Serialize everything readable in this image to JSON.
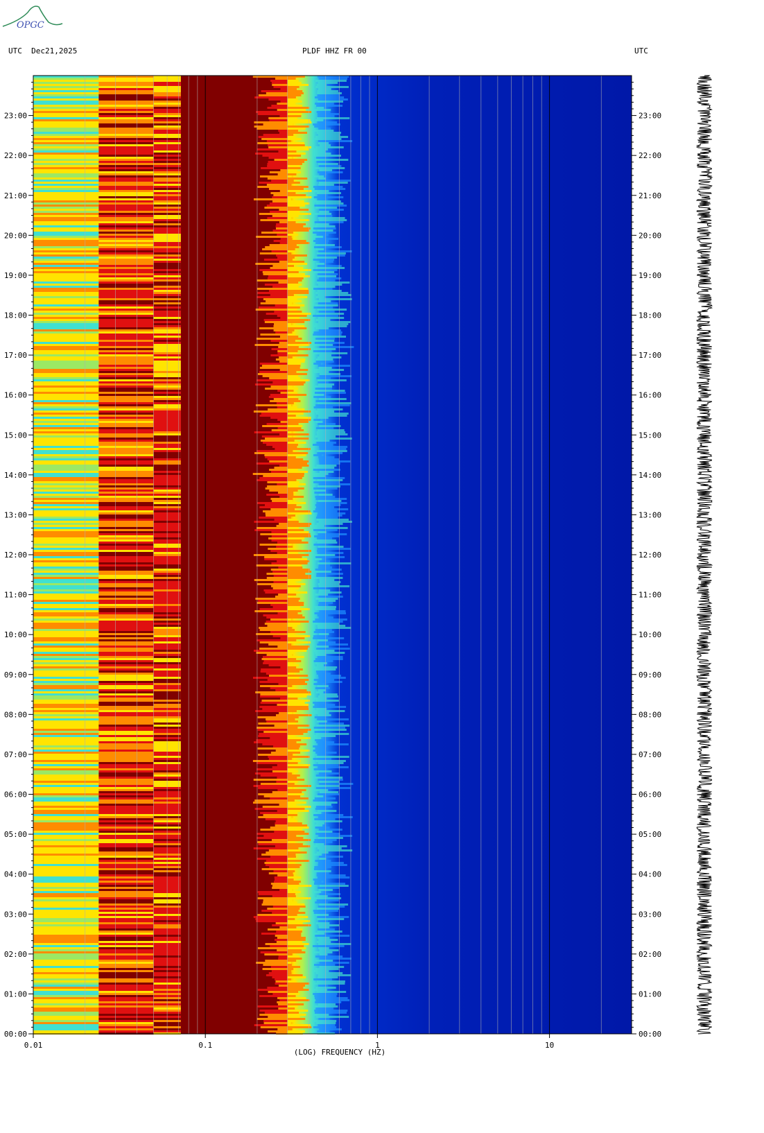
{
  "header": {
    "logo_text": "OPGC",
    "left_label": "UTC  Dec21,2025",
    "center_label": "PLDF HHZ FR 00",
    "right_label": "UTC"
  },
  "colors": {
    "dark_red": "#800000",
    "red": "#e01010",
    "orange": "#ff8c00",
    "yellow": "#ffe400",
    "cyan": "#40e0d0",
    "light_blue": "#1e90ff",
    "blue": "#0020c0",
    "dark_blue": "#0010a0"
  },
  "chart_data": {
    "type": "heatmap",
    "title": "PLDF HHZ FR 00",
    "date": "Dec21,2025",
    "xlabel": "(LOG) FREQUENCY (HZ)",
    "ylabel": "UTC",
    "x_scale": "log",
    "x_range": [
      0.01,
      30
    ],
    "x_tick_labels": [
      "0.01",
      "0.1",
      "1",
      "10"
    ],
    "y_range_hours": [
      0,
      24
    ],
    "y_tick_labels": [
      "00:00",
      "01:00",
      "02:00",
      "03:00",
      "04:00",
      "05:00",
      "06:00",
      "07:00",
      "08:00",
      "09:00",
      "10:00",
      "11:00",
      "12:00",
      "13:00",
      "14:00",
      "15:00",
      "16:00",
      "17:00",
      "18:00",
      "19:00",
      "20:00",
      "21:00",
      "22:00",
      "23:00"
    ],
    "bands": [
      {
        "f_start": 0.01,
        "f_end": 0.024,
        "color": "yellow-cyan"
      },
      {
        "f_start": 0.024,
        "f_end": 0.05,
        "color": "red-yellow"
      },
      {
        "f_start": 0.05,
        "f_end": 0.072,
        "color": "red-orange"
      },
      {
        "f_start": 0.072,
        "f_end": 0.3,
        "color": "dark-red"
      },
      {
        "f_start": 0.3,
        "f_end": 0.6,
        "color": "yellow-cyan-light-blue"
      },
      {
        "f_start": 0.6,
        "f_end": 30,
        "color": "blue"
      }
    ],
    "seismogram": "continuous trace 00:00–24:00"
  }
}
